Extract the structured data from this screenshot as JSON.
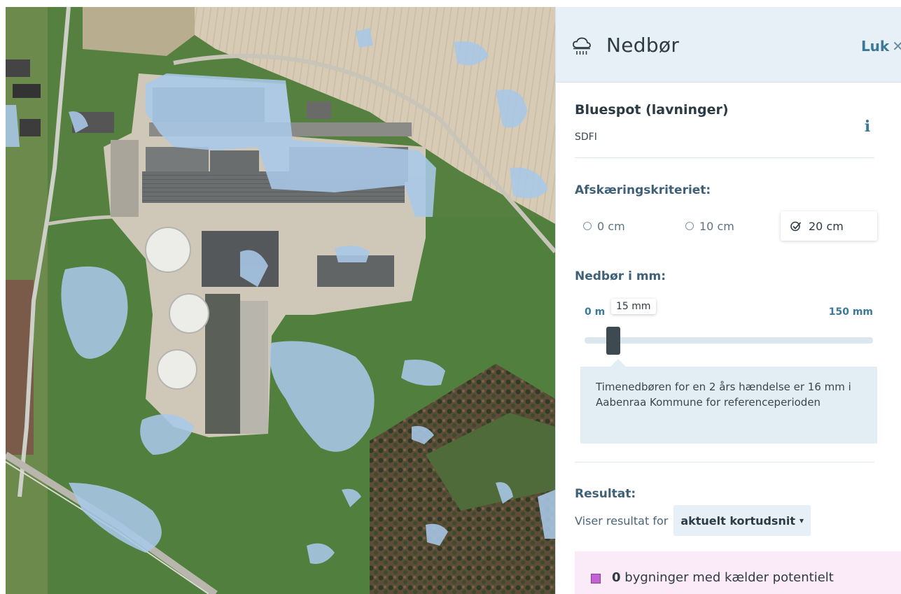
{
  "panel": {
    "title": "Nedbør",
    "header_icon": "rain-cloud-icon",
    "close_label": "Luk",
    "close_icon": "close-icon"
  },
  "layer": {
    "title": "Bluespot (lavninger)",
    "source": "SDFI",
    "info_icon": "info-icon"
  },
  "criteria": {
    "label": "Afskæringskriteriet:",
    "options": [
      {
        "label": "0 cm",
        "selected": false
      },
      {
        "label": "10 cm",
        "selected": false
      },
      {
        "label": "20 cm",
        "selected": true
      }
    ]
  },
  "rain": {
    "label": "Nedbør i mm:",
    "min_label": "0 m",
    "max_label": "150 mm",
    "tooltip": "15 mm",
    "value": 15,
    "min": 0,
    "max": 150,
    "info_text": "Timenedbøren for en 2 års hændelse er 16 mm i Aabenraa Kommune for referenceperioden"
  },
  "result": {
    "label": "Resultat:",
    "prefix": "Viser resultat for",
    "scope": "aktuelt kortudsnit",
    "count": "0",
    "text": "bygninger med kælder potentielt",
    "legend_color": "#c163d4"
  },
  "colors": {
    "accent": "#3a7a98",
    "water": "#a9c8e8",
    "header_bg": "#e7f0f7"
  }
}
